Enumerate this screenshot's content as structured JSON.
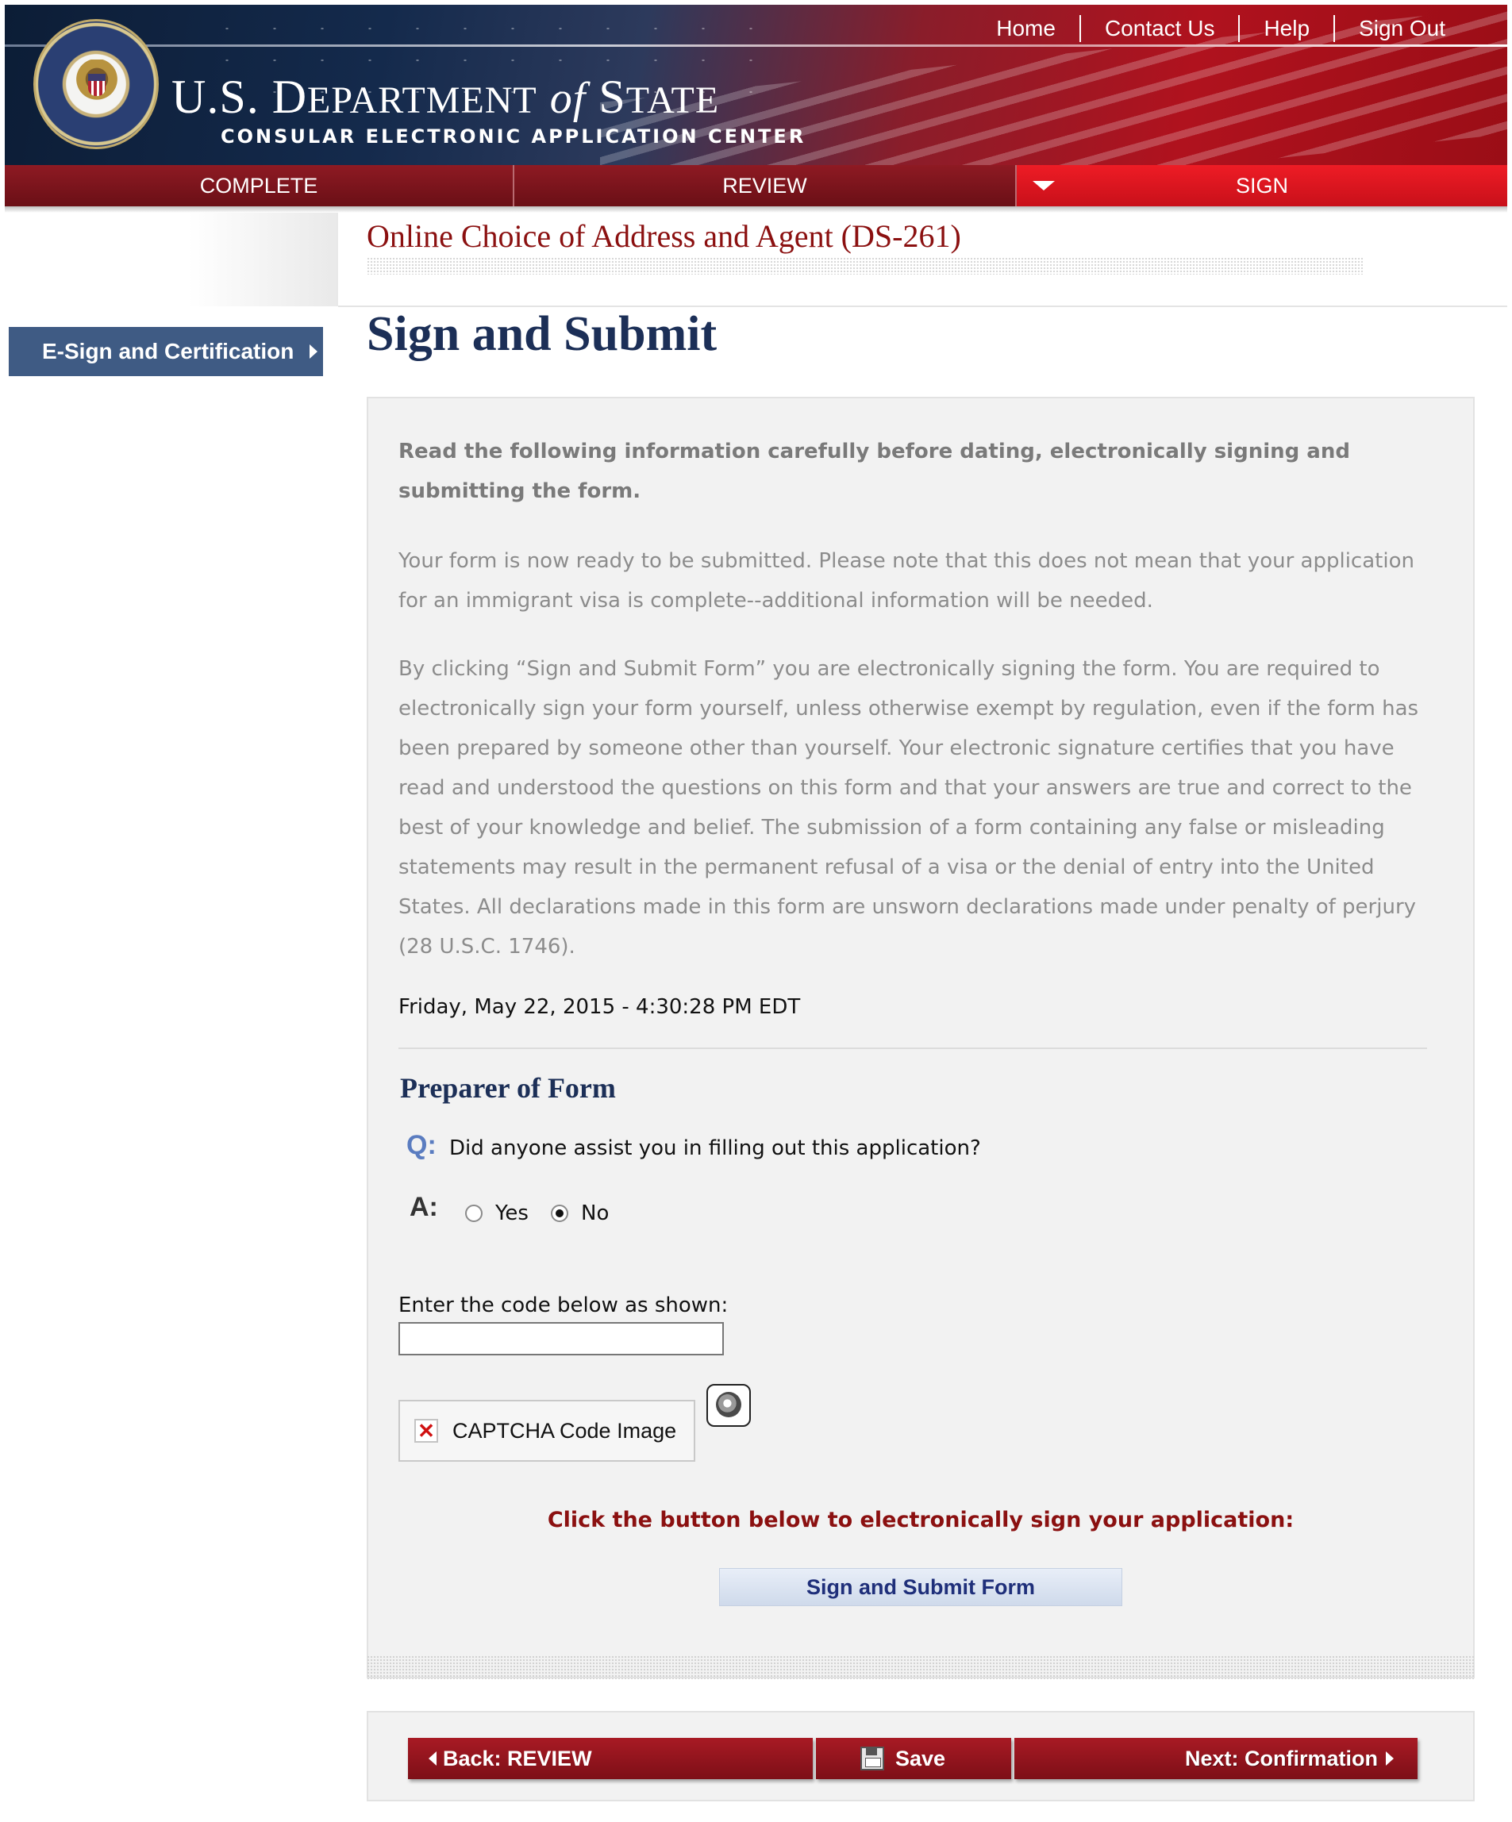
{
  "header": {
    "top_nav": [
      "Home",
      "Contact Us",
      "Help",
      "Sign Out"
    ],
    "dept_title_us": "U.S. D",
    "dept_title_epartment": "EPARTMENT",
    "dept_title_of": "of",
    "dept_title_s": "S",
    "dept_title_tate": "TATE",
    "dept_subtitle": "CONSULAR ELECTRONIC APPLICATION CENTER",
    "seal_icon": "department-of-state-seal"
  },
  "steps": [
    {
      "label": "COMPLETE",
      "active": false
    },
    {
      "label": "REVIEW",
      "active": false
    },
    {
      "label": "SIGN",
      "active": true
    }
  ],
  "sidebar": {
    "items": [
      {
        "label": "E-Sign and Certification",
        "icon": "chevron-right-icon"
      }
    ]
  },
  "page": {
    "form_title": "Online Choice of Address and Agent (DS-261)",
    "heading": "Sign and Submit"
  },
  "panel": {
    "intro_bold": "Read the following information carefully before dating, electronically signing and submitting the form.",
    "ready_text": "Your form is now ready to be submitted. Please note that this does not mean that your application for an immigrant visa is complete--additional information will be needed.",
    "legal_text": "By clicking “Sign and Submit Form” you are electronically signing the form. You are required to electronically sign your form yourself, unless otherwise exempt by regulation, even if the form has been prepared by someone other than yourself. Your electronic signature certifies that you have read and understood the questions on this form and that your answers are true and correct to the best of your knowledge and belief. The submission of a form containing any false or misleading statements may result in the permanent refusal of a visa or the denial of entry into the United States. All declarations made in this form are unsworn declarations made under penalty of perjury (28 U.S.C. 1746).",
    "timestamp": "Friday, May 22, 2015 - 4:30:28 PM EDT",
    "preparer_heading": "Preparer of Form",
    "question_label": "Q:",
    "question": "Did anyone assist you in filling out this application?",
    "answer_label": "A:",
    "options": [
      {
        "label": "Yes",
        "checked": false
      },
      {
        "label": "No",
        "checked": true
      }
    ],
    "code_label": "Enter the code below as shown:",
    "code_value": "",
    "captcha_alt": "CAPTCHA Code Image",
    "captcha_icon": "broken-image-icon",
    "audio_icon": "speaker-icon",
    "sign_prompt": "Click the button below to electronically sign your application:",
    "sign_button": "Sign and Submit Form"
  },
  "bottom_nav": {
    "back": "Back: REVIEW",
    "save": "Save",
    "next": "Next: Confirmation"
  },
  "colors": {
    "brand_red": "#b0121e",
    "navy": "#1c2f57",
    "sidebar_blue": "#3f5b84",
    "prompt_red": "#8b1010"
  }
}
